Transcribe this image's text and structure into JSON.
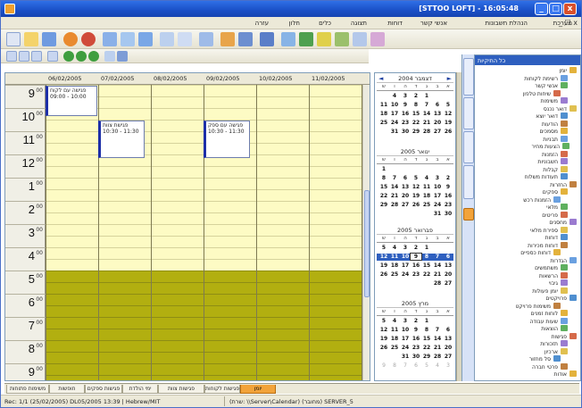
{
  "titlebar": {
    "title": "[STTOO LOFT] - 16:05:48"
  },
  "window_buttons": {
    "minimize": "_",
    "maximize": "□",
    "close": "x"
  },
  "menubar": {
    "items": [
      "מערכת",
      "הנהלת חשבונות",
      "אנשי קשר",
      "דוחות",
      "תצוגה",
      "כלים",
      "חלון",
      "עזרה"
    ],
    "mdi_controls": "_ ☐ x"
  },
  "calendar": {
    "column_headers": [
      "06/02/2005",
      "07/02/2005",
      "08/02/2005",
      "09/02/2005",
      "10/02/2005",
      "11/02/2005"
    ],
    "hours": [
      "9",
      "10",
      "11",
      "12",
      "1",
      "2",
      "3",
      "4",
      "5",
      "6",
      "7",
      "8",
      "9"
    ],
    "minutes_label": "00",
    "colors": {
      "work_hours": "#fdfbc4",
      "off_hours": "#b2af10",
      "grid_border": "#7e7a52"
    },
    "appointments": [
      {
        "text_line1": "פגישה עם לקוח",
        "text_line2": "09:00 - 10:00"
      },
      {
        "text_line1": "פגישת צוות",
        "text_line2": "10:30 - 11:30"
      },
      {
        "text_line1": "פגישה עם ספק",
        "text_line2": "10:30 - 11:30"
      }
    ]
  },
  "mini_calendars": {
    "day_names": [
      "א",
      "ב",
      "ג",
      "ד",
      "ה",
      "ו",
      "ש"
    ],
    "months": [
      {
        "title": "דצמבר 2004",
        "weeks": [
          [
            "",
            "",
            "1",
            "2",
            "3",
            "4",
            ""
          ],
          [
            "5",
            "6",
            "7",
            "8",
            "9",
            "10",
            "11"
          ],
          [
            "12",
            "13",
            "14",
            "15",
            "16",
            "17",
            "18"
          ],
          [
            "19",
            "20",
            "21",
            "22",
            "23",
            "24",
            "25"
          ],
          [
            "26",
            "27",
            "28",
            "29",
            "30",
            "31",
            ""
          ]
        ]
      },
      {
        "title": "ינואר 2005",
        "weeks": [
          [
            "",
            "",
            "",
            "",
            "",
            "",
            "1"
          ],
          [
            "2",
            "3",
            "4",
            "5",
            "6",
            "7",
            "8"
          ],
          [
            "9",
            "10",
            "11",
            "12",
            "13",
            "14",
            "15"
          ],
          [
            "16",
            "17",
            "18",
            "19",
            "20",
            "21",
            "22"
          ],
          [
            "23",
            "24",
            "25",
            "26",
            "27",
            "28",
            "29"
          ],
          [
            "30",
            "31",
            "",
            "",
            "",
            "",
            ""
          ]
        ]
      },
      {
        "title": "פברואר 2005",
        "weeks": [
          [
            "",
            "",
            "1",
            "2",
            "3",
            "4",
            "5"
          ],
          [
            "6",
            "7",
            "8",
            "9",
            "10",
            "11",
            "12"
          ],
          [
            "13",
            "14",
            "15",
            "16",
            "17",
            "18",
            "19"
          ],
          [
            "20",
            "21",
            "22",
            "23",
            "24",
            "25",
            "26"
          ],
          [
            "27",
            "28",
            "",
            "",
            "",
            "",
            ""
          ]
        ],
        "selected_week": 1,
        "today": "9"
      },
      {
        "title": "מרץ 2005",
        "weeks": [
          [
            "",
            "",
            "1",
            "2",
            "3",
            "4",
            "5"
          ],
          [
            "6",
            "7",
            "8",
            "9",
            "10",
            "11",
            "12"
          ],
          [
            "13",
            "14",
            "15",
            "16",
            "17",
            "18",
            "19"
          ],
          [
            "20",
            "21",
            "22",
            "23",
            "24",
            "25",
            "26"
          ],
          [
            "27",
            "28",
            "29",
            "30",
            "31",
            "",
            ""
          ],
          [
            "3",
            "4",
            "5",
            "6",
            "7",
            "8",
            "9"
          ]
        ]
      }
    ]
  },
  "tree": {
    "header": "כל התיקיות",
    "items": [
      "יומן",
      "רשימת לקוחות",
      "אנשי קשר",
      "שיחות טלפון",
      "משימות",
      "דואר נכנס",
      "דואר יוצא",
      "הודעות",
      "מסמכים",
      "תבניות",
      "הצעות מחיר",
      "הזמנות",
      "חשבוניות",
      "קבלות",
      "תעודות משלוח",
      "החזרות",
      "ספקים",
      "הזמנות רכש",
      "מלאי",
      "פריטים",
      "מחסנים",
      "ספירת מלאי",
      "דוחות",
      "דוחות מכירות",
      "דוחות כספיים",
      "הגדרות",
      "משתמשים",
      "הרשאות",
      "גיבוי",
      "יומן פעולות",
      "פרויקטים",
      "משימות פרויקט",
      "לוחות זמנים",
      "שעות עבודה",
      "הוצאות",
      "פגישות",
      "תזכורות",
      "ארכיון",
      "סל מחזור",
      "פרטי חברה",
      "אודות"
    ]
  },
  "bottom_tabs": [
    "יומן",
    "פגישות לקוחות",
    "פגישות צוות",
    "ימי הולדת",
    "פגישות ספקים",
    "חופשות",
    "משימות פתוחות"
  ],
  "statusbar": {
    "left": "Rec: 1/1  (25/02/2005)  DL05/2005  13:39  |  Hebrew/MIT",
    "right": "(שרת: \\\\Server\\Calendar)  (מחובר)  SERVER_5"
  }
}
